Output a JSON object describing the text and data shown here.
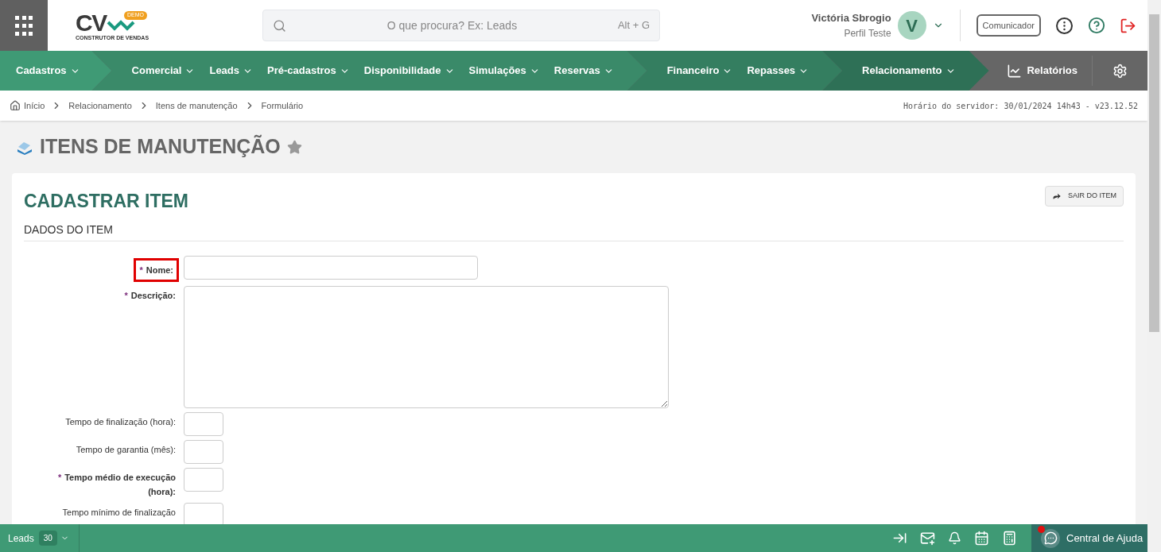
{
  "header": {
    "logo_text": "CV",
    "logo_badge": "DEMO",
    "logo_subtitle": "CONSTRUTOR DE VENDAS",
    "search": {
      "placeholder": "O que procura? Ex: Leads",
      "shortcut": "Alt + G"
    },
    "user": {
      "name": "Victória Sbrogio",
      "profile": "Perfil Teste",
      "initial": "V"
    },
    "communicator_button": "Comunicador"
  },
  "nav": {
    "groups": [
      {
        "color": "#3f9a75",
        "items": [
          "Cadastros"
        ]
      },
      {
        "color": "#3a8a69",
        "items": [
          "Comercial",
          "Leads",
          "Pré-cadastros",
          "Disponibilidade",
          "Simulações",
          "Reservas"
        ]
      },
      {
        "color": "#347e60",
        "items": [
          "Financeiro",
          "Repasses"
        ]
      },
      {
        "color": "#2e7056",
        "items": [
          "Relacionamento"
        ]
      }
    ],
    "reports": "Relatórios"
  },
  "breadcrumb": {
    "items": [
      "Início",
      "Relacionamento",
      "Itens de manutenção",
      "Formulário"
    ],
    "server_time": "Horário do servidor: 30/01/2024 14h43 - v23.12.52"
  },
  "page_title": "ITENS DE MANUTENÇÃO",
  "form": {
    "required_mark": "*",
    "title": "CADASTRAR ITEM",
    "exit_button": "SAIR DO ITEM",
    "section": "DADOS DO ITEM",
    "fields": [
      {
        "label": "Nome:",
        "kind": "text",
        "required": true,
        "highlighted": true
      },
      {
        "label": "Descrição:",
        "kind": "textarea",
        "required": true,
        "highlighted": false
      },
      {
        "label": "Tempo de finalização (hora):",
        "kind": "small",
        "required": false,
        "highlighted": false
      },
      {
        "label": "Tempo de garantia (mês):",
        "kind": "small",
        "required": false,
        "highlighted": false
      },
      {
        "label": "Tempo médio de execução (hora):",
        "kind": "small",
        "required": true,
        "highlighted": false
      },
      {
        "label": "Tempo mínimo de finalização",
        "kind": "small",
        "required": false,
        "highlighted": false
      }
    ]
  },
  "footer": {
    "leads_label": "Leads",
    "leads_count": "30",
    "help": "Central de Ajuda",
    "help_notification": true
  }
}
